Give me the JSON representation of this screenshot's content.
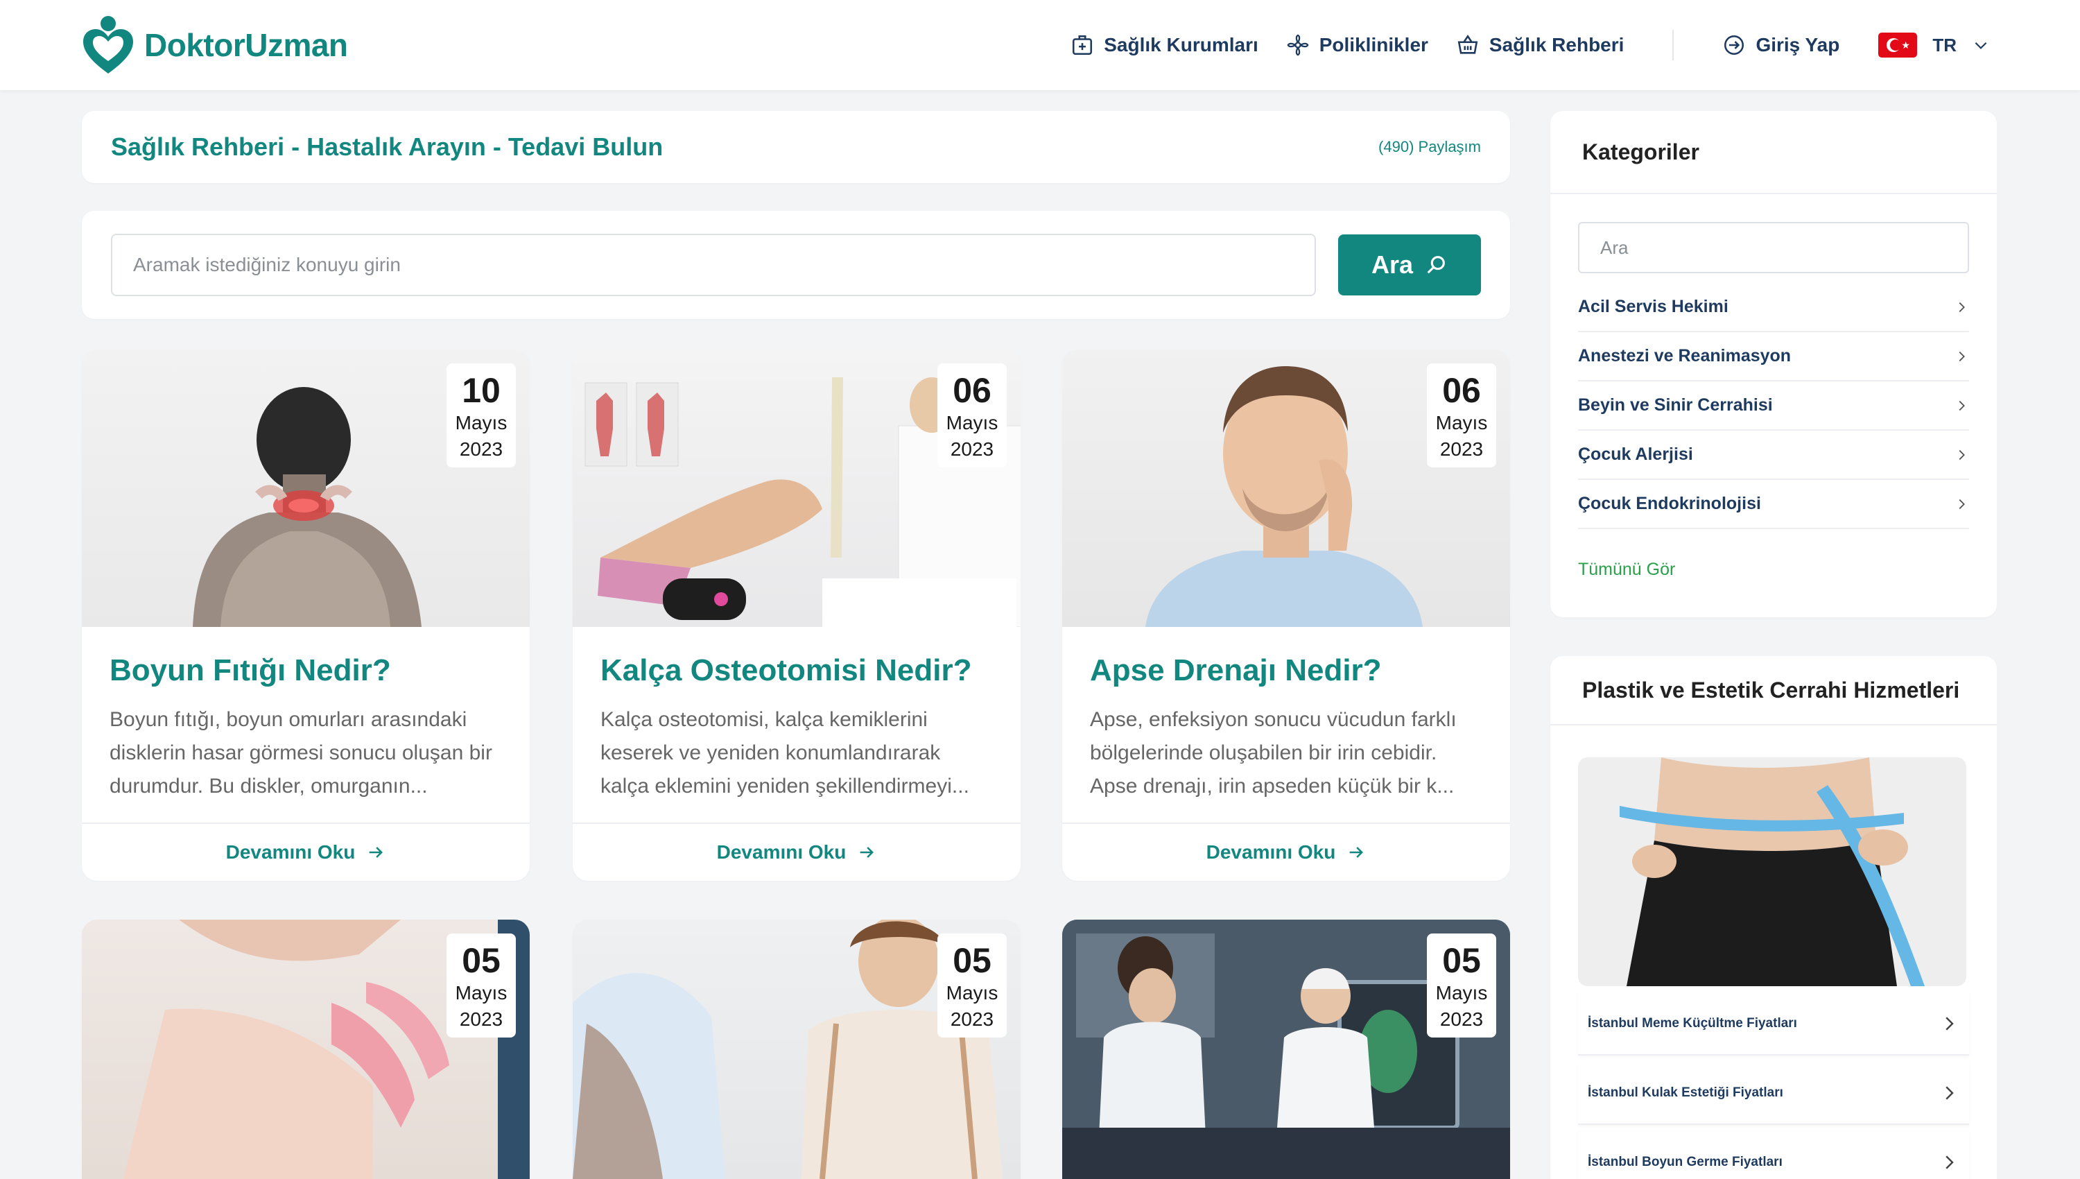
{
  "brand": {
    "name": "DoktorUzman",
    "color": "#12877f"
  },
  "nav": {
    "items": [
      {
        "label": "Sağlık Kurumları",
        "icon": "hospital-icon"
      },
      {
        "label": "Poliklinikler",
        "icon": "flower-icon"
      },
      {
        "label": "Sağlık Rehberi",
        "icon": "basket-icon"
      }
    ],
    "login_label": "Giriş Yap",
    "language": "TR"
  },
  "header": {
    "title": "Sağlık Rehberi - Hastalık Arayın - Tedavi Bulun",
    "share_count": "(490) Paylaşım"
  },
  "search": {
    "placeholder": "Aramak istediğiniz konuyu girin",
    "button_label": "Ara"
  },
  "articles": [
    {
      "title": "Boyun Fıtığı Nedir?",
      "excerpt": "Boyun fıtığı, boyun omurları arasındaki disklerin hasar görmesi sonucu oluşan bir durumdur. Bu diskler, omurganın...",
      "day": "10",
      "month": "Mayıs",
      "year": "2023",
      "read_more": "Devamını Oku"
    },
    {
      "title": "Kalça Osteotomisi Nedir?",
      "excerpt": "Kalça osteotomisi, kalça kemiklerini keserek ve yeniden konumlandırarak kalça eklemini yeniden şekillendirmeyi...",
      "day": "06",
      "month": "Mayıs",
      "year": "2023",
      "read_more": "Devamını Oku"
    },
    {
      "title": "Apse Drenajı Nedir?",
      "excerpt": "Apse, enfeksiyon sonucu vücudun farklı bölgelerinde oluşabilen bir irin cebidir. Apse drenajı, irin apseden küçük bir k...",
      "day": "06",
      "month": "Mayıs",
      "year": "2023",
      "read_more": "Devamını Oku"
    },
    {
      "day": "05",
      "month": "Mayıs",
      "year": "2023"
    },
    {
      "day": "05",
      "month": "Mayıs",
      "year": "2023"
    },
    {
      "day": "05",
      "month": "Mayıs",
      "year": "2023"
    }
  ],
  "sidebar": {
    "categories_title": "Kategoriler",
    "categories_search_placeholder": "Ara",
    "categories": [
      "Acil Servis Hekimi",
      "Anestezi ve Reanimasyon",
      "Beyin ve Sinir Cerrahisi",
      "Çocuk Alerjisi",
      "Çocuk Endokrinolojisi"
    ],
    "see_all": "Tümünü Gör",
    "plastic_title": "Plastik ve Estetik Cerrahi Hizmetleri",
    "plastic_items": [
      "İstanbul Meme Küçültme Fiyatları",
      "İstanbul Kulak Estetiği Fiyatları",
      "İstanbul Boyun Germe Fiyatları"
    ]
  }
}
